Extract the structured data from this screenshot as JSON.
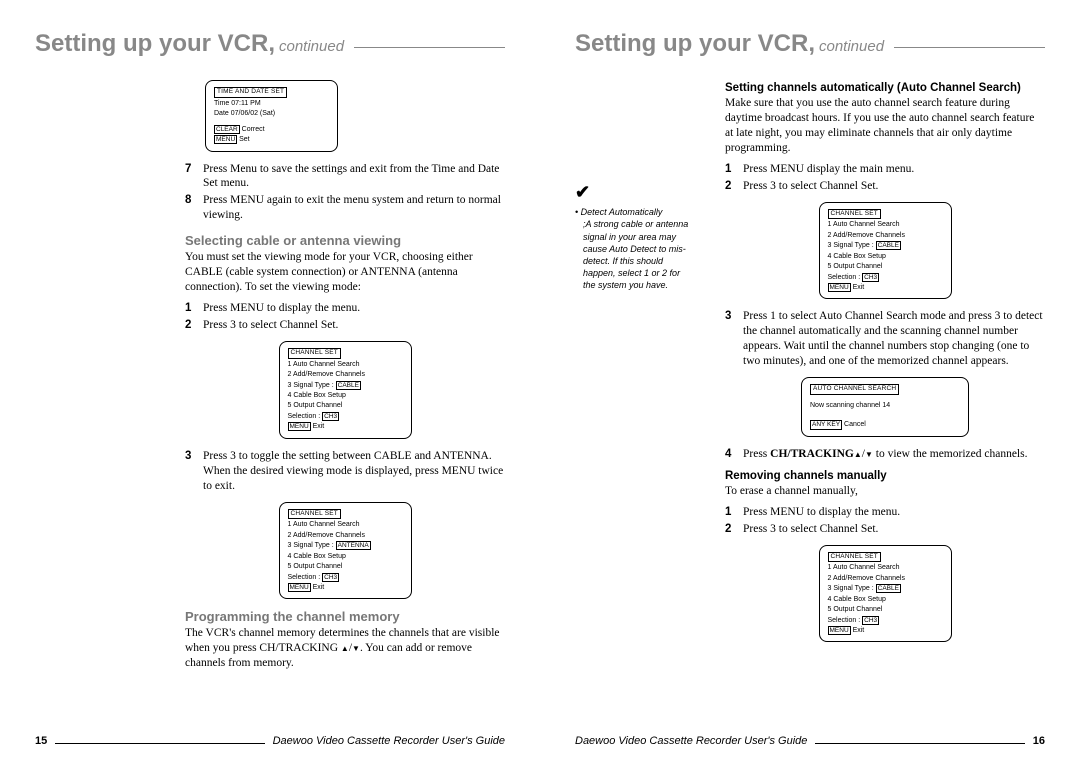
{
  "pages": {
    "left": {
      "title_main": "Setting up your VCR,",
      "title_cont": "continued",
      "osd_time": {
        "title": "TIME AND DATE SET",
        "l1": "Time   07:11 PM",
        "l2": "Date   07/06/02 (Sat)",
        "clear": "CLEAR",
        "clear_txt": " Correct",
        "menu": "MENU",
        "menu_txt": " Set"
      },
      "step7": "Press Menu to save the settings and exit from the Time and Date Set menu.",
      "step8": "Press MENU again to exit the menu system and return to normal viewing.",
      "sec1_head": "Selecting cable or antenna viewing",
      "sec1_body": "You must set the viewing mode for your VCR, choosing either CABLE (cable system connection) or ANTENNA (antenna connection). To set the viewing mode:",
      "sec1_s1": "Press MENU to display the menu.",
      "sec1_s2": "Press 3 to select  Channel Set.",
      "osd_cs1": {
        "title": "CHANNEL SET",
        "l1": "1 Auto Channel Search",
        "l2": "2 Add/Remove Channels",
        "l3a": "3 Signal Type   : ",
        "l3b": "CABLE",
        "l4": "4 Cable Box Setup",
        "l5": "5 Output Channel",
        "l6a": "   Selection : ",
        "l6b": "CH3",
        "menu": "MENU",
        "menu_txt": " Exit"
      },
      "sec1_s3": "Press 3 to toggle the setting between CABLE and ANTENNA. When the desired viewing mode is displayed, press MENU twice to exit.",
      "osd_cs2": {
        "title": "CHANNEL SET",
        "l1": "1 Auto Channel Search",
        "l2": "2 Add/Remove Channels",
        "l3a": "3 Signal Type   : ",
        "l3b": "ANTENNA",
        "l4": "4 Cable Box Setup",
        "l5": "5 Output Channel",
        "l6a": "   Selection : ",
        "l6b": "CH3",
        "menu": "MENU",
        "menu_txt": " Exit"
      },
      "sec2_head": "Programming the channel memory",
      "sec2_body_a": "The VCR's channel memory determines the channels that are  visible when you press CH/TRACKING ",
      "sec2_body_b": ". You can add or remove channels from memory.",
      "page_num": "15",
      "footer_title": "Daewoo Video Cassette Recorder User's Guide"
    },
    "right": {
      "title_main": "Setting up your VCR,",
      "title_cont": "continued",
      "note_head": "Detect Automatically",
      "note_body": ";A strong cable or antenna signal in your area may cause Auto Detect to mis-detect. If this should happen, select 1 or 2 for the system you have.",
      "sec_head": "Setting channels automatically (Auto Channel Search)",
      "sec_body": "Make sure that you use the auto channel search feature during daytime broadcast hours. If you use the auto channel search feature at late night, you may eliminate channels that air only daytime programming.",
      "s1": "Press MENU display the main menu.",
      "s2": "Press 3 to select Channel Set.",
      "osd_cs": {
        "title": "CHANNEL SET",
        "l1": "1 Auto Channel Search",
        "l2": "2 Add/Remove Channels",
        "l3a": "3 Signal Type   : ",
        "l3b": "CABLE",
        "l4": "4 Cable Box Setup",
        "l5": "5 Output Channel",
        "l6a": "   Selection : ",
        "l6b": "CH3",
        "menu": "MENU",
        "menu_txt": " Exit"
      },
      "s3": "Press 1 to select Auto Channel Search mode and press 3 to detect the channel automatically and the scanning channel number appears. Wait until the channel numbers stop changing (one to two minutes), and one of the memorized channel appears.",
      "osd_acs": {
        "title": "AUTO CHANNEL SEARCH",
        "l1": "Now scanning channel 14",
        "anykey": "ANY KEY",
        "anykey_txt": " Cancel"
      },
      "s4a": "Press ",
      "s4b": "CH/TRACKING",
      "s4c": " to view the memorized channels.",
      "sec2_head": "Removing channels manually",
      "sec2_body": "To erase a channel manually,",
      "sec2_s1": "Press MENU to display the menu.",
      "sec2_s2": "Press 3 to select Channel Set.",
      "osd_cs2": {
        "title": "CHANNEL SET",
        "l1": "1 Auto Channel Search",
        "l2": "2 Add/Remove Channels",
        "l3a": "3 Signal Type   : ",
        "l3b": "CABLE",
        "l4": "4 Cable Box Setup",
        "l5": "5 Output Channel",
        "l6a": "   Selection : ",
        "l6b": "CH3",
        "menu": "MENU",
        "menu_txt": " Exit"
      },
      "page_num": "16",
      "footer_title": "Daewoo Video Cassette Recorder User's Guide"
    }
  }
}
